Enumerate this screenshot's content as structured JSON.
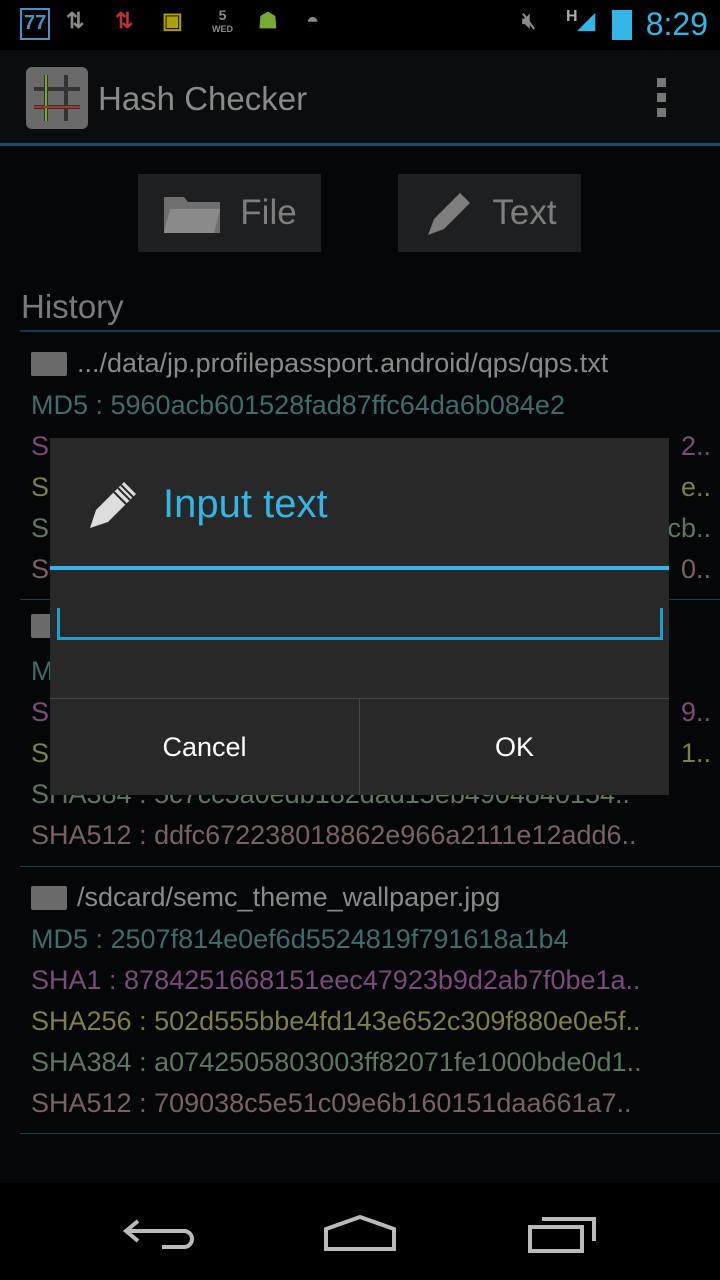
{
  "status_bar": {
    "time": "8:29",
    "notifications": [
      "77",
      "sync-icon",
      "data-updown-icon",
      "sim-icon",
      "calendar-5-wed",
      "android-icon",
      "android-head-icon"
    ],
    "calendar_day": "5",
    "calendar_weekday": "WED",
    "badge": "77",
    "network": "H"
  },
  "action_bar": {
    "title": "Hash Checker",
    "overflow_icon": "overflow-menu-icon"
  },
  "buttons": {
    "file": "File",
    "text": "Text"
  },
  "history": {
    "label": "History",
    "entries": [
      {
        "path": ".../data/jp.profilepassport.android/qps/qps.txt",
        "md5": "MD5 : 5960acb601528fad87ffc64da6b084e2",
        "sha1_prefix": "S",
        "sha1_suffix": "2..",
        "sha256_prefix": "S",
        "sha256_suffix": "e..",
        "sha384_prefix": "S",
        "sha384_suffix": "cb..",
        "sha512_prefix": "S",
        "sha512_suffix": "0.."
      },
      {
        "md5_prefix": "M",
        "sha1_prefix": "S",
        "sha1_suffix": "9..",
        "sha256_prefix": "S",
        "sha256_suffix": "1..",
        "sha384": "SHA384 : 5c7cc5a0edb182dad15eb4904840154..",
        "sha512": "SHA512 : ddfc672238018862e966a2111e12add6.."
      },
      {
        "path": "/sdcard/semc_theme_wallpaper.jpg",
        "md5": "MD5 : 2507f814e0ef6d5524819f791618a1b4",
        "sha1": "SHA1 : 8784251668151eec47923b9d2ab7f0be1a..",
        "sha256": "SHA256 : 502d555bbe4fd143e652c309f880e0e5f..",
        "sha384": "SHA384 : a0742505803003ff82071fe1000bde0d1..",
        "sha512": "SHA512 : 709038c5e51c09e6b160151daa661a7.."
      }
    ]
  },
  "dialog": {
    "title": "Input text",
    "icon": "pencil-icon",
    "input_value": "",
    "cancel": "Cancel",
    "ok": "OK"
  },
  "colors": {
    "accent": "#33b5e5",
    "md5": "#3f6d6d",
    "sha1": "#7b4b7b",
    "sha256": "#7f7f46",
    "sha384": "#5f7760",
    "sha512": "#7a6262"
  }
}
